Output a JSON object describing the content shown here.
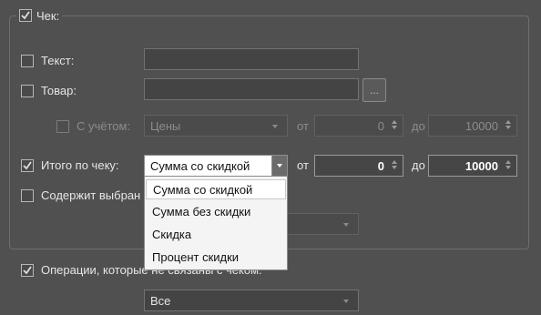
{
  "group": {
    "label": "Чек:",
    "checked": true
  },
  "text_filter": {
    "label": "Текст:",
    "checked": false,
    "value": ""
  },
  "product_filter": {
    "label": "Товар:",
    "checked": false,
    "value": "",
    "browse_label": "..."
  },
  "consider": {
    "label": "С учётом:",
    "checked": false,
    "combo_value": "Цены",
    "from_label": "от",
    "from_value": "0",
    "to_label": "до",
    "to_value": "10000"
  },
  "total": {
    "label": "Итого по чеку:",
    "checked": true,
    "combo_value": "Сумма со скидкой",
    "from_label": "от",
    "from_value": "0",
    "to_label": "до",
    "to_value": "10000"
  },
  "contains_selected": {
    "label": "Содержит выбран",
    "checked": false
  },
  "dropdown": {
    "options": [
      "Сумма со скидкой",
      "Сумма без скидки",
      "Скидка",
      "Процент скидки"
    ],
    "selected_index": 0
  },
  "unlinked_ops": {
    "label": "Операции, которые не связаны с чеком:",
    "checked": true,
    "combo_value": "Все"
  },
  "colors": {
    "background": "#505050",
    "text": "#e6e6e6",
    "disabled_text": "#8c8c8c",
    "popup_background": "#f4f4f4"
  }
}
